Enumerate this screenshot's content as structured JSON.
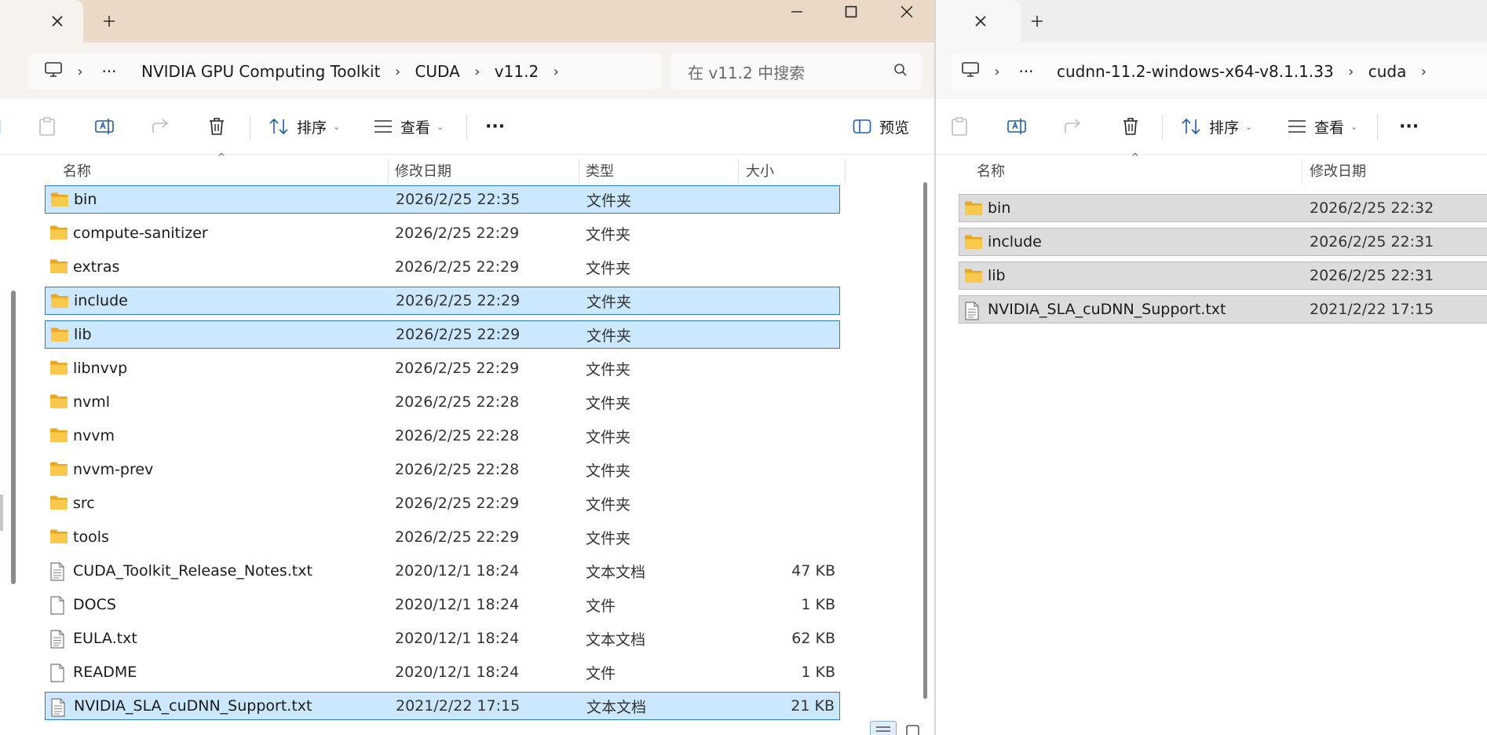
{
  "left_window": {
    "tab": {
      "close_label": "✕",
      "add_label": "+"
    },
    "caption": {
      "minimize": "—",
      "maximize": "☐",
      "close": "✕"
    },
    "breadcrumb": {
      "more": "···",
      "items": [
        "NVIDIA GPU Computing Toolkit",
        "CUDA",
        "v11.2"
      ],
      "trailing_sep": "›"
    },
    "search": {
      "placeholder": "在 v11.2 中搜索"
    },
    "toolbar": {
      "sort_label": "排序",
      "view_label": "查看",
      "more_label": "···",
      "preview_label": "预览"
    },
    "columns": {
      "name": "名称",
      "modified": "修改日期",
      "type": "类型",
      "size": "大小"
    },
    "rows": [
      {
        "name": "bin",
        "date": "2026/2/25 22:35",
        "type": "文件夹",
        "size": "",
        "icon": "folder-icon",
        "selected": true
      },
      {
        "name": "compute-sanitizer",
        "date": "2026/2/25 22:29",
        "type": "文件夹",
        "size": "",
        "icon": "folder-icon",
        "selected": false
      },
      {
        "name": "extras",
        "date": "2026/2/25 22:29",
        "type": "文件夹",
        "size": "",
        "icon": "folder-icon",
        "selected": false
      },
      {
        "name": "include",
        "date": "2026/2/25 22:29",
        "type": "文件夹",
        "size": "",
        "icon": "folder-icon",
        "selected": true
      },
      {
        "name": "lib",
        "date": "2026/2/25 22:29",
        "type": "文件夹",
        "size": "",
        "icon": "folder-icon",
        "selected": true
      },
      {
        "name": "libnvvp",
        "date": "2026/2/25 22:29",
        "type": "文件夹",
        "size": "",
        "icon": "folder-icon",
        "selected": false
      },
      {
        "name": "nvml",
        "date": "2026/2/25 22:28",
        "type": "文件夹",
        "size": "",
        "icon": "folder-icon",
        "selected": false
      },
      {
        "name": "nvvm",
        "date": "2026/2/25 22:28",
        "type": "文件夹",
        "size": "",
        "icon": "folder-icon",
        "selected": false
      },
      {
        "name": "nvvm-prev",
        "date": "2026/2/25 22:28",
        "type": "文件夹",
        "size": "",
        "icon": "folder-icon",
        "selected": false
      },
      {
        "name": "src",
        "date": "2026/2/25 22:29",
        "type": "文件夹",
        "size": "",
        "icon": "folder-icon",
        "selected": false
      },
      {
        "name": "tools",
        "date": "2026/2/25 22:29",
        "type": "文件夹",
        "size": "",
        "icon": "folder-icon",
        "selected": false
      },
      {
        "name": "CUDA_Toolkit_Release_Notes.txt",
        "date": "2020/12/1 18:24",
        "type": "文本文档",
        "size": "47 KB",
        "icon": "text-file-icon",
        "selected": false
      },
      {
        "name": "DOCS",
        "date": "2020/12/1 18:24",
        "type": "文件",
        "size": "1 KB",
        "icon": "file-icon",
        "selected": false
      },
      {
        "name": "EULA.txt",
        "date": "2020/12/1 18:24",
        "type": "文本文档",
        "size": "62 KB",
        "icon": "text-file-icon",
        "selected": false
      },
      {
        "name": "README",
        "date": "2020/12/1 18:24",
        "type": "文件",
        "size": "1 KB",
        "icon": "file-icon",
        "selected": false
      },
      {
        "name": "NVIDIA_SLA_cuDNN_Support.txt",
        "date": "2021/2/22 17:15",
        "type": "文本文档",
        "size": "21 KB",
        "icon": "text-file-icon",
        "selected": true
      }
    ]
  },
  "right_window": {
    "tab": {
      "close_label": "✕",
      "add_label": "+"
    },
    "breadcrumb": {
      "more": "···",
      "items": [
        "cudnn-11.2-windows-x64-v8.1.1.33",
        "cuda"
      ],
      "trailing_sep": "›"
    },
    "toolbar": {
      "sort_label": "排序",
      "view_label": "查看",
      "more_label": "···"
    },
    "columns": {
      "name": "名称",
      "modified": "修改日期"
    },
    "rows": [
      {
        "name": "bin",
        "date": "2026/2/25 22:32",
        "icon": "folder-icon",
        "selected": true
      },
      {
        "name": "include",
        "date": "2026/2/25 22:31",
        "icon": "folder-icon",
        "selected": true
      },
      {
        "name": "lib",
        "date": "2026/2/25 22:31",
        "icon": "folder-icon",
        "selected": true
      },
      {
        "name": "NVIDIA_SLA_cuDNN_Support.txt",
        "date": "2021/2/22 17:15",
        "icon": "text-file-icon",
        "selected": true
      }
    ]
  },
  "colors": {
    "left_titlebar": "#ead9c6",
    "selection_fill": "#cce8fe",
    "selection_border": "#2b7bd6",
    "inactive_selection_fill": "#dcdcdc",
    "folder_yellow": "#f8c94c"
  }
}
